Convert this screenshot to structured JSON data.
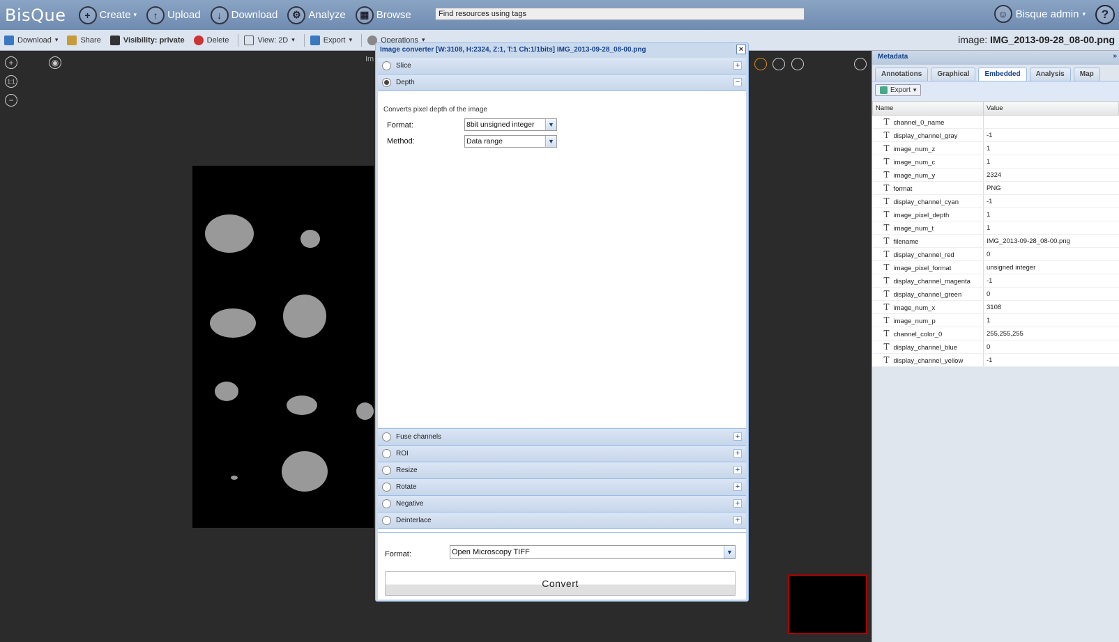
{
  "app": {
    "logo": "BisQue"
  },
  "topnav": {
    "create": "Create",
    "upload": "Upload",
    "download": "Download",
    "analyze": "Analyze",
    "browse": "Browse",
    "search_value": "Find resources using tags",
    "user": "Bisque admin",
    "help": "?"
  },
  "toolbar": {
    "download": "Download",
    "share": "Share",
    "visibility": "Visibility: private",
    "delete": "Delete",
    "view": "View: 2D",
    "export": "Export",
    "operations": "Operations"
  },
  "image_title": {
    "label": "image:",
    "name": "IMG_2013-09-28_08-00.png"
  },
  "viewer": {
    "zoom_in": "+",
    "one_to_one": "1:1",
    "zoom_out": "−",
    "label": "Im"
  },
  "dialog": {
    "title": "Image converter [W:3108, H:2324, Z:1, T:1 Ch:1/1bits] IMG_2013-09-28_08-00.png",
    "close": "×",
    "sections_top": [
      {
        "label": "Slice",
        "toggle": "+"
      },
      {
        "label": "Depth",
        "toggle": "−"
      }
    ],
    "depth": {
      "description": "Converts pixel depth of the image",
      "format_label": "Format:",
      "format_value": "8bit unsigned integer",
      "method_label": "Method:",
      "method_value": "Data range"
    },
    "sections_bottom": [
      {
        "label": "Fuse channels",
        "toggle": "+"
      },
      {
        "label": "ROI",
        "toggle": "+"
      },
      {
        "label": "Resize",
        "toggle": "+"
      },
      {
        "label": "Rotate",
        "toggle": "+"
      },
      {
        "label": "Negative",
        "toggle": "+"
      },
      {
        "label": "Deinterlace",
        "toggle": "+"
      }
    ],
    "output_format_label": "Format:",
    "output_format_value": "Open Microscopy TIFF",
    "convert": "Convert"
  },
  "metadata": {
    "title": "Metadata",
    "tabs": [
      "Annotations",
      "Graphical",
      "Embedded",
      "Analysis",
      "Map"
    ],
    "active_tab": "Embedded",
    "export": "Export",
    "columns": [
      "Name",
      "Value"
    ],
    "rows": [
      {
        "name": "channel_0_name",
        "value": ""
      },
      {
        "name": "display_channel_gray",
        "value": "-1"
      },
      {
        "name": "image_num_z",
        "value": "1"
      },
      {
        "name": "image_num_c",
        "value": "1"
      },
      {
        "name": "image_num_y",
        "value": "2324"
      },
      {
        "name": "format",
        "value": "PNG"
      },
      {
        "name": "display_channel_cyan",
        "value": "-1"
      },
      {
        "name": "image_pixel_depth",
        "value": "1"
      },
      {
        "name": "image_num_t",
        "value": "1"
      },
      {
        "name": "filename",
        "value": "IMG_2013-09-28_08-00.png"
      },
      {
        "name": "display_channel_red",
        "value": "0"
      },
      {
        "name": "image_pixel_format",
        "value": "unsigned integer"
      },
      {
        "name": "display_channel_magenta",
        "value": "-1"
      },
      {
        "name": "display_channel_green",
        "value": "0"
      },
      {
        "name": "image_num_x",
        "value": "3108"
      },
      {
        "name": "image_num_p",
        "value": "1"
      },
      {
        "name": "channel_color_0",
        "value": "255,255,255"
      },
      {
        "name": "display_channel_blue",
        "value": "0"
      },
      {
        "name": "display_channel_yellow",
        "value": "-1"
      }
    ]
  },
  "colors": {
    "topbar": "#7a94b8",
    "panel_header": "#15428b",
    "accent_border": "#99bbe8"
  }
}
